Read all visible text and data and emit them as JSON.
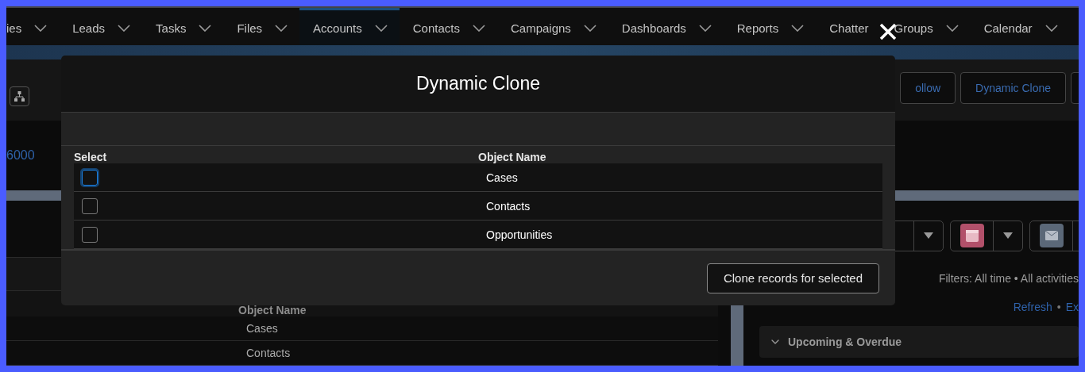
{
  "nav": {
    "tabs": [
      {
        "label": "ies",
        "selected": false,
        "menu": true
      },
      {
        "label": "Leads",
        "selected": false,
        "menu": true
      },
      {
        "label": "Tasks",
        "selected": false,
        "menu": true
      },
      {
        "label": "Files",
        "selected": false,
        "menu": true
      },
      {
        "label": "Accounts",
        "selected": true,
        "menu": true
      },
      {
        "label": "Contacts",
        "selected": false,
        "menu": true
      },
      {
        "label": "Campaigns",
        "selected": false,
        "menu": true
      },
      {
        "label": "Dashboards",
        "selected": false,
        "menu": true
      },
      {
        "label": "Reports",
        "selected": false,
        "menu": true
      },
      {
        "label": "Chatter",
        "selected": false,
        "menu": false
      },
      {
        "label": "Groups",
        "selected": false,
        "menu": true
      },
      {
        "label": "Calendar",
        "selected": false,
        "menu": true
      }
    ]
  },
  "header": {
    "buttons": [
      "ollow",
      "Dynamic Clone"
    ]
  },
  "highlights": {
    "value": "6000"
  },
  "related": {
    "column": "Object Name",
    "rows": [
      "Cases",
      "Contacts"
    ]
  },
  "activity": {
    "filters": "Filters: All time • All activities",
    "links": [
      "Refresh",
      "•",
      "Ex"
    ],
    "section": "Upcoming & Overdue"
  },
  "modal": {
    "title": "Dynamic Clone",
    "columns": [
      "Select",
      "Object Name"
    ],
    "rows": [
      {
        "name": "Cases",
        "checked": false,
        "focused": true
      },
      {
        "name": "Contacts",
        "checked": false,
        "focused": false
      },
      {
        "name": "Opportunities",
        "checked": false,
        "focused": false
      }
    ],
    "action": "Clone records for selected"
  }
}
